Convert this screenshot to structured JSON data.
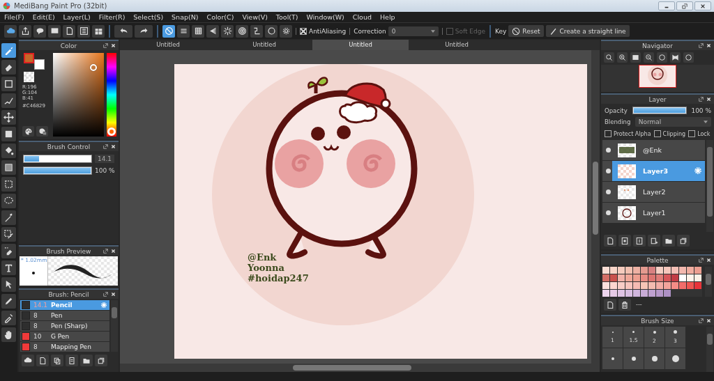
{
  "window": {
    "title": "MediBang Paint Pro (32bit)"
  },
  "menu": [
    "File(F)",
    "Edit(E)",
    "Layer(L)",
    "Filter(R)",
    "Select(S)",
    "Snap(N)",
    "Color(C)",
    "View(V)",
    "Tool(T)",
    "Window(W)",
    "Cloud",
    "Help"
  ],
  "toolbar": {
    "buttons": [
      {
        "kind": "cloud"
      },
      {
        "kind": "share"
      },
      {
        "kind": "comment"
      },
      {
        "kind": "note"
      },
      {
        "kind": "page"
      },
      {
        "kind": "list"
      },
      {
        "kind": "layout"
      }
    ],
    "history": [
      {
        "kind": "undo"
      },
      {
        "kind": "redo"
      }
    ],
    "snaps": [
      {
        "kind": "snap-off",
        "selected": true
      },
      {
        "kind": "parallel",
        "selected": false
      },
      {
        "kind": "grid",
        "selected": false
      },
      {
        "kind": "perspective",
        "selected": false
      },
      {
        "kind": "radial",
        "selected": false
      },
      {
        "kind": "concentric",
        "selected": false
      },
      {
        "kind": "curve",
        "selected": false
      },
      {
        "kind": "circle",
        "selected": false
      },
      {
        "kind": "gear",
        "selected": false
      }
    ],
    "antialiasing": {
      "label": "AntiAliasing",
      "checked": true
    },
    "correction": {
      "label": "Correction",
      "value": "0"
    },
    "soft_edge": {
      "label": "Soft Edge",
      "checked": false,
      "disabled": true
    },
    "key_label": "Key",
    "reset_button": "Reset",
    "straight_line_button": "Create a straight line"
  },
  "tools": [
    {
      "kind": "brush",
      "selected": true
    },
    {
      "kind": "eraser",
      "selected": false
    },
    {
      "kind": "rect",
      "selected": false
    },
    {
      "kind": "vector",
      "selected": false
    },
    {
      "kind": "move",
      "selected": false
    },
    {
      "kind": "fill",
      "selected": false
    },
    {
      "kind": "bucket",
      "selected": false
    },
    {
      "kind": "gradient",
      "selected": false
    },
    {
      "kind": "select-rect",
      "selected": false
    },
    {
      "kind": "lasso",
      "selected": false
    },
    {
      "kind": "wand",
      "selected": false
    },
    {
      "kind": "select-pen",
      "selected": false
    },
    {
      "kind": "select-eraser",
      "selected": false
    },
    {
      "kind": "text",
      "selected": false
    },
    {
      "kind": "operation",
      "selected": false
    },
    {
      "kind": "pen",
      "selected": false
    },
    {
      "kind": "dropper",
      "selected": false
    },
    {
      "kind": "hand",
      "selected": false
    }
  ],
  "color_panel": {
    "title": "Color",
    "hue": {
      "level": 0.02
    },
    "rgb": [
      "R:196",
      "G:104",
      "B:41"
    ],
    "hex": "#C46829"
  },
  "brush_control": {
    "title": "Brush Control",
    "size": {
      "level": 0.22,
      "value": "14.1"
    },
    "opacity": {
      "level": 1,
      "value": "100 %"
    }
  },
  "brush_preview": {
    "title": "Brush Preview",
    "size": "* 1.02mm"
  },
  "brushes": {
    "title": "Brush: Pencil",
    "items": [
      {
        "color": "#2e2e2e",
        "size": "14.1",
        "name": "Pencil",
        "selected": true
      },
      {
        "color": "#2e2e2e",
        "size": "8",
        "name": "Pen",
        "selected": false
      },
      {
        "color": "#2e2e2e",
        "size": "8",
        "name": "Pen (Sharp)",
        "selected": false
      },
      {
        "color": "#f03a3a",
        "size": "10",
        "name": "G Pen",
        "selected": false
      },
      {
        "color": "#f03a3a",
        "size": "8",
        "name": "Mapping Pen",
        "selected": false
      }
    ]
  },
  "canvas": {
    "tabs": [
      {
        "label": "Untitled",
        "selected": false
      },
      {
        "label": "Untitled",
        "selected": false
      },
      {
        "label": "Untitled",
        "selected": true
      },
      {
        "label": "Untitled",
        "selected": false
      }
    ],
    "signature": [
      "@Enk",
      "Yoonna",
      "#hoidap247"
    ]
  },
  "navigator": {
    "title": "Navigator"
  },
  "layer": {
    "title": "Layer",
    "opacity_label": "Opacity",
    "opacity": {
      "level": 1,
      "value": "100 %"
    },
    "blending_label": "Blending",
    "blending": "Normal",
    "options": [
      {
        "label": "Protect Alpha",
        "checked": false
      },
      {
        "label": "Clipping",
        "checked": false
      },
      {
        "label": "Lock",
        "checked": false
      }
    ],
    "layers": [
      {
        "name": "@Enk",
        "kind": "text",
        "selected": false
      },
      {
        "name": "Layer3",
        "kind": "blank",
        "selected": true
      },
      {
        "name": "Layer2",
        "kind": "dots",
        "selected": false
      },
      {
        "name": "Layer1",
        "kind": "character",
        "selected": false
      }
    ]
  },
  "palette": {
    "title": "Palette",
    "current": "---",
    "colors": [
      {
        "color": "#f9dcd3"
      },
      {
        "color": "#f8d5c8"
      },
      {
        "color": "#f5cbbd"
      },
      {
        "color": "#f2c0b0"
      },
      {
        "color": "#eeb1a3"
      },
      {
        "color": "#e49a8f"
      },
      {
        "color": "#d88080"
      },
      {
        "color": "#f6cfc4"
      },
      {
        "color": "#f5c6bc"
      },
      {
        "color": "#f4bfb5"
      },
      {
        "color": "#f3b8ae"
      },
      {
        "color": "#f0ad9f"
      },
      {
        "color": "#ec9e90"
      },
      {
        "color": "#d46e66"
      },
      {
        "color": "#c9514d"
      },
      {
        "color": "#f3b2a8"
      },
      {
        "color": "#f0a798"
      },
      {
        "color": "#ee9f90"
      },
      {
        "color": "#e78b82"
      },
      {
        "color": "#dd7470"
      },
      {
        "color": "#e07c78"
      },
      {
        "color": "#d7565a"
      },
      {
        "color": "#c23c44"
      },
      {
        "color": "#ffffff"
      },
      {
        "color": "#fff4ea"
      },
      {
        "color": "#fbf1e6"
      },
      {
        "color": "#fde0dc"
      },
      {
        "color": "#fcd6d0"
      },
      {
        "color": "#f9cdc7"
      },
      {
        "color": "#f8c4bd"
      },
      {
        "color": "#f6bbb3"
      },
      {
        "color": "#f6c5b6"
      },
      {
        "color": "#f4bbb0"
      },
      {
        "color": "#f3ada6"
      },
      {
        "color": "#f2a39c"
      },
      {
        "color": "#f48c86"
      },
      {
        "color": "#f16d6a"
      },
      {
        "color": "#ef5652"
      },
      {
        "color": "#e8343a"
      },
      {
        "color": "#ecd4ec"
      },
      {
        "color": "#e6cae6"
      },
      {
        "color": "#dec3e3"
      },
      {
        "color": "#d7bde0"
      },
      {
        "color": "#cfb5dc"
      },
      {
        "color": "#c9acd7"
      },
      {
        "color": "#bea0cf"
      },
      {
        "color": "#b597c8"
      },
      {
        "color": "#ad90c4"
      }
    ]
  },
  "brush_size": {
    "title": "Brush Size",
    "sizes": [
      {
        "label": "1"
      },
      {
        "label": "1.5"
      },
      {
        "label": "2"
      },
      {
        "label": "3"
      }
    ]
  }
}
